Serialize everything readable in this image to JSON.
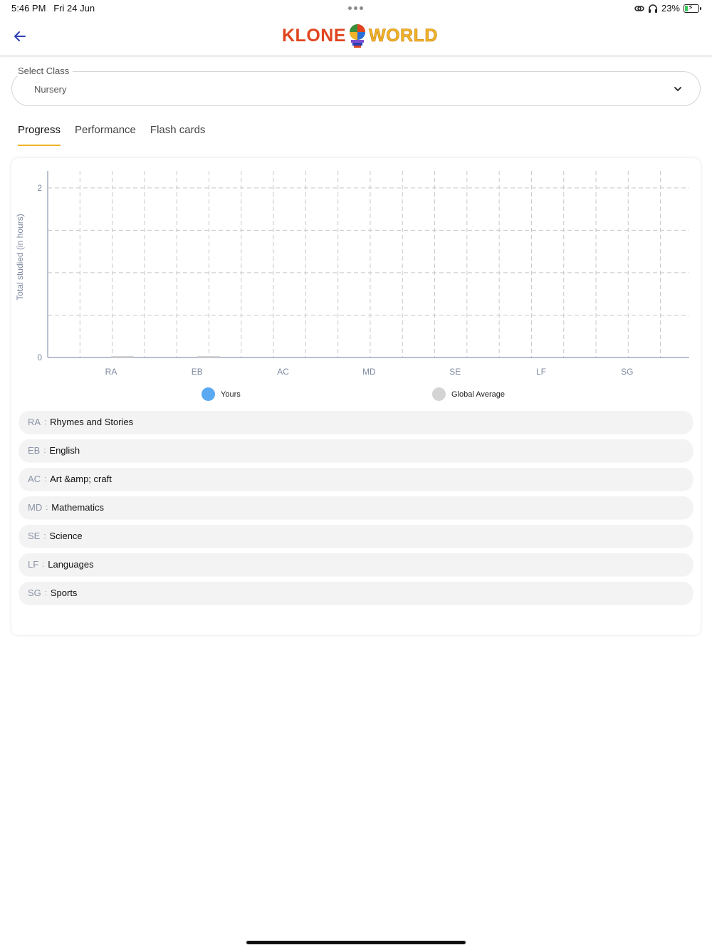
{
  "status_bar": {
    "time": "5:46 PM",
    "date": "Fri 24 Jun",
    "battery": "23%",
    "battery_level": 0.23,
    "icons": [
      "link-icon",
      "headphones-icon",
      "battery-charging-icon"
    ]
  },
  "header": {
    "back_icon": "arrow-left-icon",
    "logo_left": "KLONE",
    "logo_right": "WORLD",
    "colors": {
      "klone": "#e0451f",
      "world": "#f0b327",
      "back_arrow": "#2a3fb5"
    }
  },
  "select_class": {
    "label": "Select Class",
    "value": "Nursery",
    "icon": "chevron-down-icon"
  },
  "tabs": [
    {
      "label": "Progress",
      "active": true
    },
    {
      "label": "Performance",
      "active": false
    },
    {
      "label": "Flash cards",
      "active": false
    }
  ],
  "chart_data": {
    "type": "bar",
    "ylabel": "Total studied (in hours)",
    "xlabel": "",
    "ylim": [
      0,
      2.2
    ],
    "y_ticks": [
      0,
      2
    ],
    "grid": true,
    "categories": [
      "RA",
      "EB",
      "AC",
      "MD",
      "SE",
      "LF",
      "SG"
    ],
    "series": [
      {
        "name": "Yours",
        "color": "#5aa9f2",
        "values": [
          0,
          0,
          0,
          0,
          0,
          0,
          0
        ]
      },
      {
        "name": "Global Average",
        "color": "#d4d4d4",
        "values": [
          0.01,
          0.01,
          0,
          0,
          0,
          0,
          0
        ]
      }
    ],
    "legend_position": "bottom"
  },
  "subjects": [
    {
      "code": "RA",
      "name": "Rhymes and Stories"
    },
    {
      "code": "EB",
      "name": "English"
    },
    {
      "code": "AC",
      "name": "Art &amp; craft"
    },
    {
      "code": "MD",
      "name": "Mathematics"
    },
    {
      "code": "SE",
      "name": "Science"
    },
    {
      "code": "LF",
      "name": "Languages"
    },
    {
      "code": "SG",
      "name": "Sports"
    }
  ],
  "subject_separator": ":"
}
